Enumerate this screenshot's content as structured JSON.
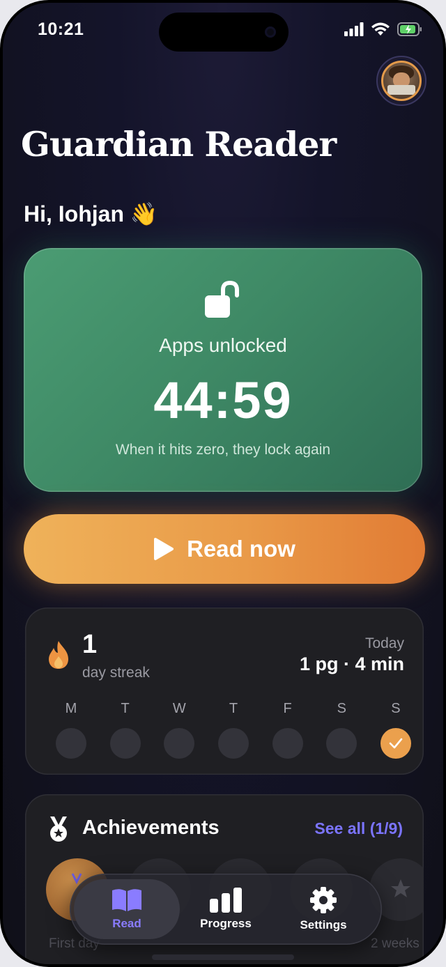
{
  "status_bar": {
    "time": "10:21"
  },
  "app": {
    "title": "Guardian Reader"
  },
  "greeting": "Hi, Iohjan 👋",
  "unlock_card": {
    "label": "Apps unlocked",
    "timer": "44:59",
    "hint": "When it hits zero, they lock again"
  },
  "read_button": {
    "label": "Read now"
  },
  "streak": {
    "count": "1",
    "label": "day streak",
    "today_label": "Today",
    "today_value": "1 pg · 4 min",
    "days": [
      {
        "letter": "M",
        "done": false
      },
      {
        "letter": "T",
        "done": false
      },
      {
        "letter": "W",
        "done": false
      },
      {
        "letter": "T",
        "done": false
      },
      {
        "letter": "F",
        "done": false
      },
      {
        "letter": "S",
        "done": false
      },
      {
        "letter": "S",
        "done": true
      }
    ]
  },
  "achievements": {
    "title": "Achievements",
    "see_all": "See all (1/9)",
    "badges": [
      {
        "label": "First day",
        "unlocked": true
      },
      {
        "label": "",
        "unlocked": false
      },
      {
        "label": "",
        "unlocked": false
      },
      {
        "label": "",
        "unlocked": false
      },
      {
        "label": "2 weeks",
        "unlocked": false
      }
    ]
  },
  "tabbar": {
    "items": [
      {
        "label": "Read",
        "icon": "book-icon",
        "active": true
      },
      {
        "label": "Progress",
        "icon": "bar-chart-icon",
        "active": false
      },
      {
        "label": "Settings",
        "icon": "gear-icon",
        "active": false
      }
    ]
  },
  "colors": {
    "unlock_green": "#3f8a66",
    "read_orange": "#e99a48",
    "accent_purple": "#7b74ff",
    "streak_done": "#eba04d"
  }
}
